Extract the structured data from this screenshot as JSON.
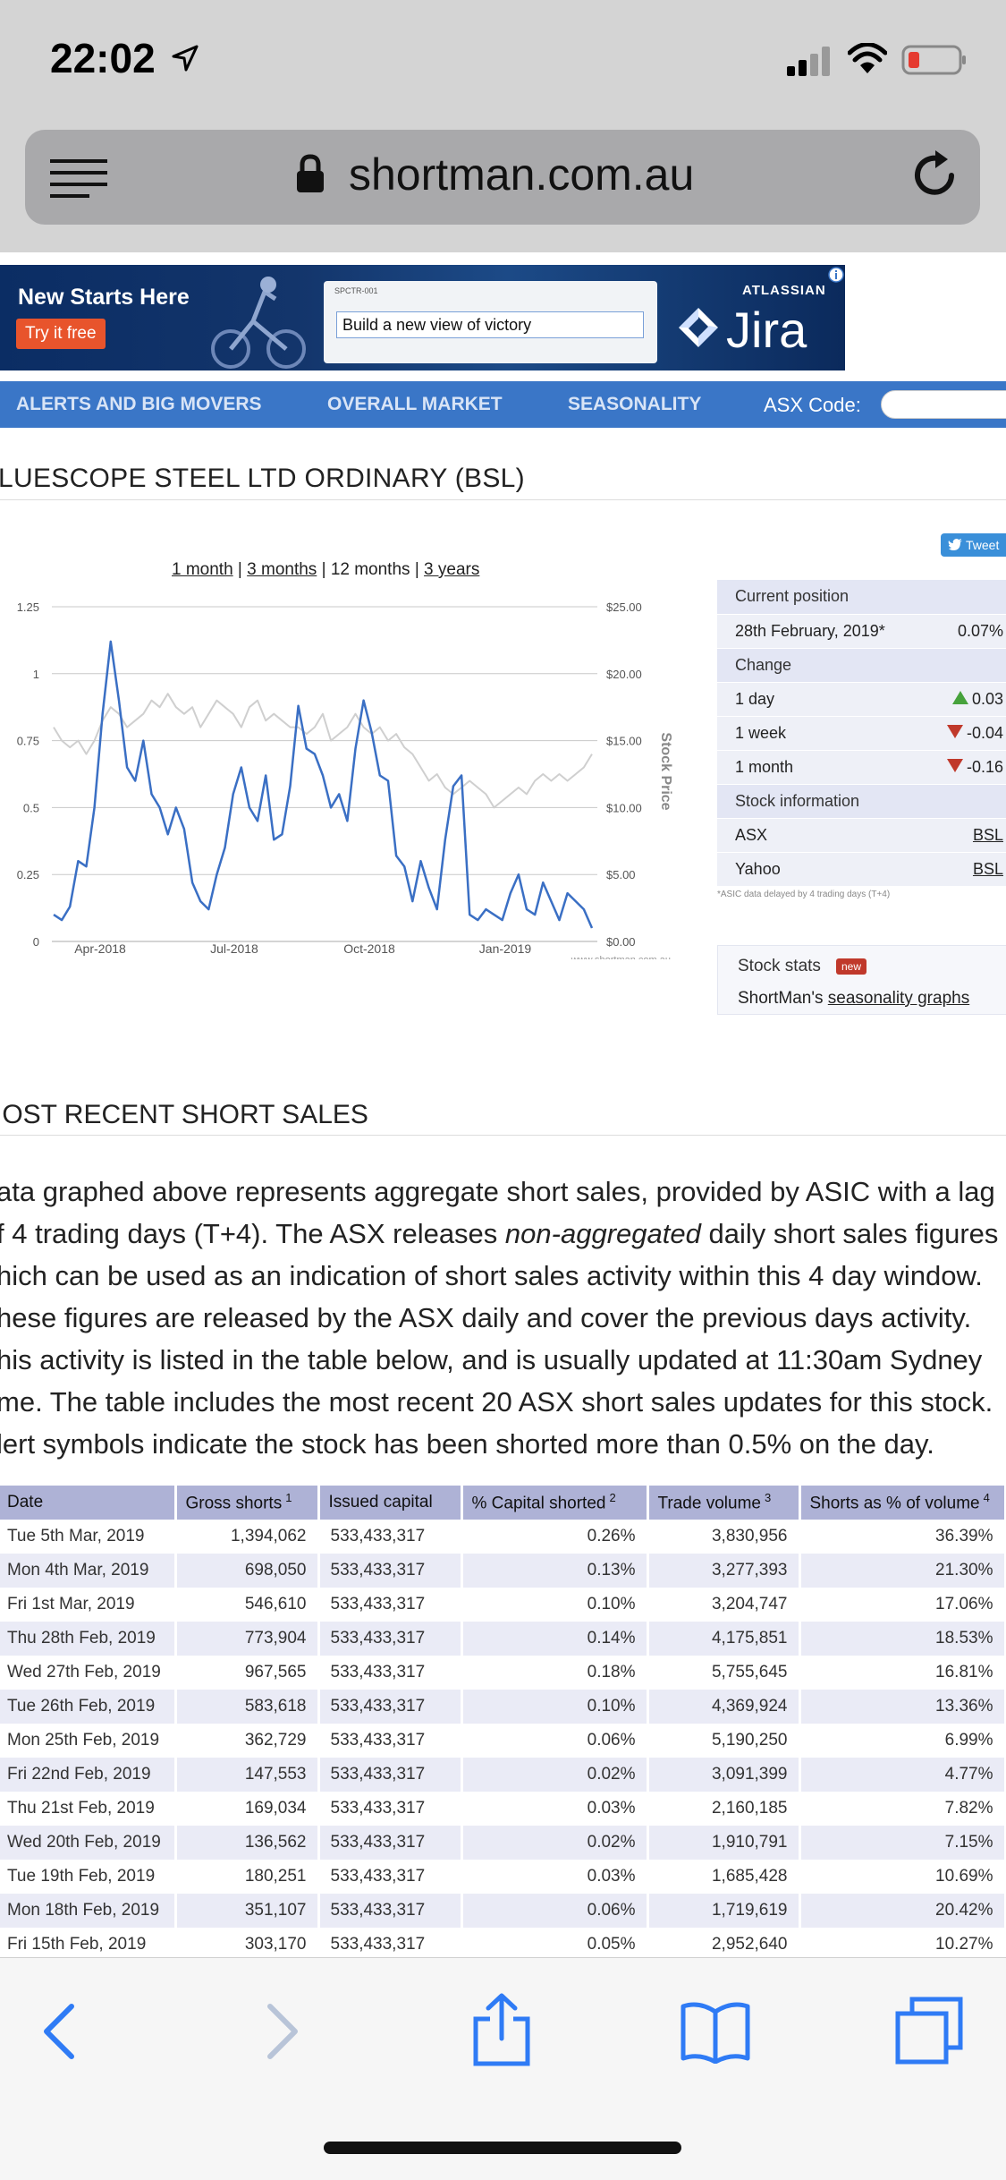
{
  "status_bar": {
    "time": "22:02"
  },
  "browser": {
    "url": "shortman.com.au"
  },
  "ad": {
    "headline": "New Starts Here",
    "cta": "Try it free",
    "card_tag": "SPCTR-001",
    "card_text": "Build a new view of victory",
    "brand": "ATLASSIAN",
    "product": "Jira"
  },
  "nav": {
    "items": [
      "ALERTS AND BIG MOVERS",
      "OVERALL MARKET",
      "SEASONALITY"
    ],
    "asx_label": "ASX Code:"
  },
  "stock_title": "LUESCOPE STEEL LTD ORDINARY (BSL)",
  "tweet": "Tweet",
  "range": {
    "one_month": "1 month",
    "three_months": "3 months",
    "twelve_months": "12 months",
    "three_years": "3 years"
  },
  "info": {
    "current_position_label": "Current position",
    "date": "28th February, 2019*",
    "date_value": "0.07%",
    "change_label": "Change",
    "day_label": "1 day",
    "day_value": "0.03",
    "week_label": "1 week",
    "week_value": "-0.04",
    "month_label": "1 month",
    "month_value": "-0.16",
    "stock_info_label": "Stock information",
    "asx_label": "ASX",
    "asx_link": "BSL",
    "yahoo_label": "Yahoo",
    "yahoo_link": "BSL",
    "note": "*ASIC data delayed by 4 trading days (T+4)"
  },
  "stats": {
    "title": "Stock stats",
    "badge": "new",
    "prefix": "ShortMan's ",
    "link": "seasonality graphs"
  },
  "chart_data": {
    "type": "line",
    "x": [
      "Apr-2018",
      "Jul-2018",
      "Oct-2018",
      "Jan-2019"
    ],
    "left_axis_ticks": [
      "0",
      "0.25",
      "0.5",
      "0.75",
      "1",
      "1.25"
    ],
    "right_axis_ticks": [
      "$0.00",
      "$5.00",
      "$10.00",
      "$15.00",
      "$20.00",
      "$25.00"
    ],
    "right_axis_label": "Stock Price",
    "ylim_left": [
      0,
      1.25
    ],
    "ylim_right": [
      0,
      25
    ],
    "watermark": "www.shortman.com.au",
    "series": [
      {
        "color": "#3a6fc4",
        "values": [
          0.1,
          0.08,
          0.13,
          0.3,
          0.28,
          0.5,
          0.85,
          1.12,
          0.9,
          0.65,
          0.6,
          0.75,
          0.55,
          0.5,
          0.4,
          0.5,
          0.42,
          0.22,
          0.15,
          0.12,
          0.25,
          0.35,
          0.55,
          0.65,
          0.5,
          0.45,
          0.62,
          0.38,
          0.4,
          0.58,
          0.88,
          0.72,
          0.7,
          0.62,
          0.5,
          0.55,
          0.45,
          0.72,
          0.9,
          0.78,
          0.62,
          0.6,
          0.32,
          0.28,
          0.15,
          0.3,
          0.2,
          0.12,
          0.38,
          0.58,
          0.62,
          0.1,
          0.08,
          0.12,
          0.1,
          0.08,
          0.18,
          0.25,
          0.12,
          0.1,
          0.22,
          0.15,
          0.08,
          0.18,
          0.15,
          0.12,
          0.05
        ]
      },
      {
        "color": "#cfcfcf",
        "values": [
          16,
          15,
          14.5,
          15,
          14,
          15,
          16.5,
          17.5,
          17,
          16,
          16.5,
          17,
          18,
          17.5,
          18.5,
          17.5,
          17,
          17.5,
          16,
          17,
          18,
          17.5,
          17,
          16,
          17.5,
          18,
          16.5,
          17,
          16.5,
          16,
          16,
          15.5,
          16,
          17,
          15,
          15.5,
          16,
          17,
          16,
          15.5,
          16,
          15,
          15.5,
          14.5,
          14,
          13,
          12,
          12.5,
          11.5,
          11,
          11.5,
          12,
          11.5,
          11,
          10,
          10.5,
          11,
          11.5,
          11,
          12,
          12.5,
          12,
          12.5,
          12,
          12.5,
          13,
          14
        ]
      }
    ]
  },
  "section_title": "IOST RECENT SHORT SALES",
  "paragraph_lines": [
    "ata graphed above represents aggregate short sales, provided by ASIC with a lag",
    "f 4 trading days (T+4). The ASX releases |non-aggregated| daily short sales figures",
    "hich can be used as an indication of short sales activity within this 4 day window.",
    "hese figures are released by the ASX daily and cover the previous days activity.",
    "his activity is listed in the table below, and is usually updated at 11:30am Sydney",
    "me. The table includes the most recent 20 ASX short sales updates for this stock.",
    "lert symbols indicate the stock has been shorted more than 0.5% on the day."
  ],
  "short_table": {
    "headers": [
      "Date",
      "Gross shorts",
      "Issued capital",
      "% Capital shorted",
      "Trade volume",
      "Shorts as % of volume"
    ],
    "header_sups": [
      "",
      "1",
      "",
      "2",
      "3",
      "4"
    ],
    "rows": [
      [
        "Tue 5th Mar, 2019",
        "1,394,062",
        "533,433,317",
        "0.26%",
        "3,830,956",
        "36.39%"
      ],
      [
        "Mon 4th Mar, 2019",
        "698,050",
        "533,433,317",
        "0.13%",
        "3,277,393",
        "21.30%"
      ],
      [
        "Fri 1st Mar, 2019",
        "546,610",
        "533,433,317",
        "0.10%",
        "3,204,747",
        "17.06%"
      ],
      [
        "Thu 28th Feb, 2019",
        "773,904",
        "533,433,317",
        "0.14%",
        "4,175,851",
        "18.53%"
      ],
      [
        "Wed 27th Feb, 2019",
        "967,565",
        "533,433,317",
        "0.18%",
        "5,755,645",
        "16.81%"
      ],
      [
        "Tue 26th Feb, 2019",
        "583,618",
        "533,433,317",
        "0.10%",
        "4,369,924",
        "13.36%"
      ],
      [
        "Mon 25th Feb, 2019",
        "362,729",
        "533,433,317",
        "0.06%",
        "5,190,250",
        "6.99%"
      ],
      [
        "Fri 22nd Feb, 2019",
        "147,553",
        "533,433,317",
        "0.02%",
        "3,091,399",
        "4.77%"
      ],
      [
        "Thu 21st Feb, 2019",
        "169,034",
        "533,433,317",
        "0.03%",
        "2,160,185",
        "7.82%"
      ],
      [
        "Wed 20th Feb, 2019",
        "136,562",
        "533,433,317",
        "0.02%",
        "1,910,791",
        "7.15%"
      ],
      [
        "Tue 19th Feb, 2019",
        "180,251",
        "533,433,317",
        "0.03%",
        "1,685,428",
        "10.69%"
      ],
      [
        "Mon 18th Feb, 2019",
        "351,107",
        "533,433,317",
        "0.06%",
        "1,719,619",
        "20.42%"
      ],
      [
        "Fri 15th Feb, 2019",
        "303,170",
        "533,433,317",
        "0.05%",
        "2,952,640",
        "10.27%"
      ]
    ]
  }
}
